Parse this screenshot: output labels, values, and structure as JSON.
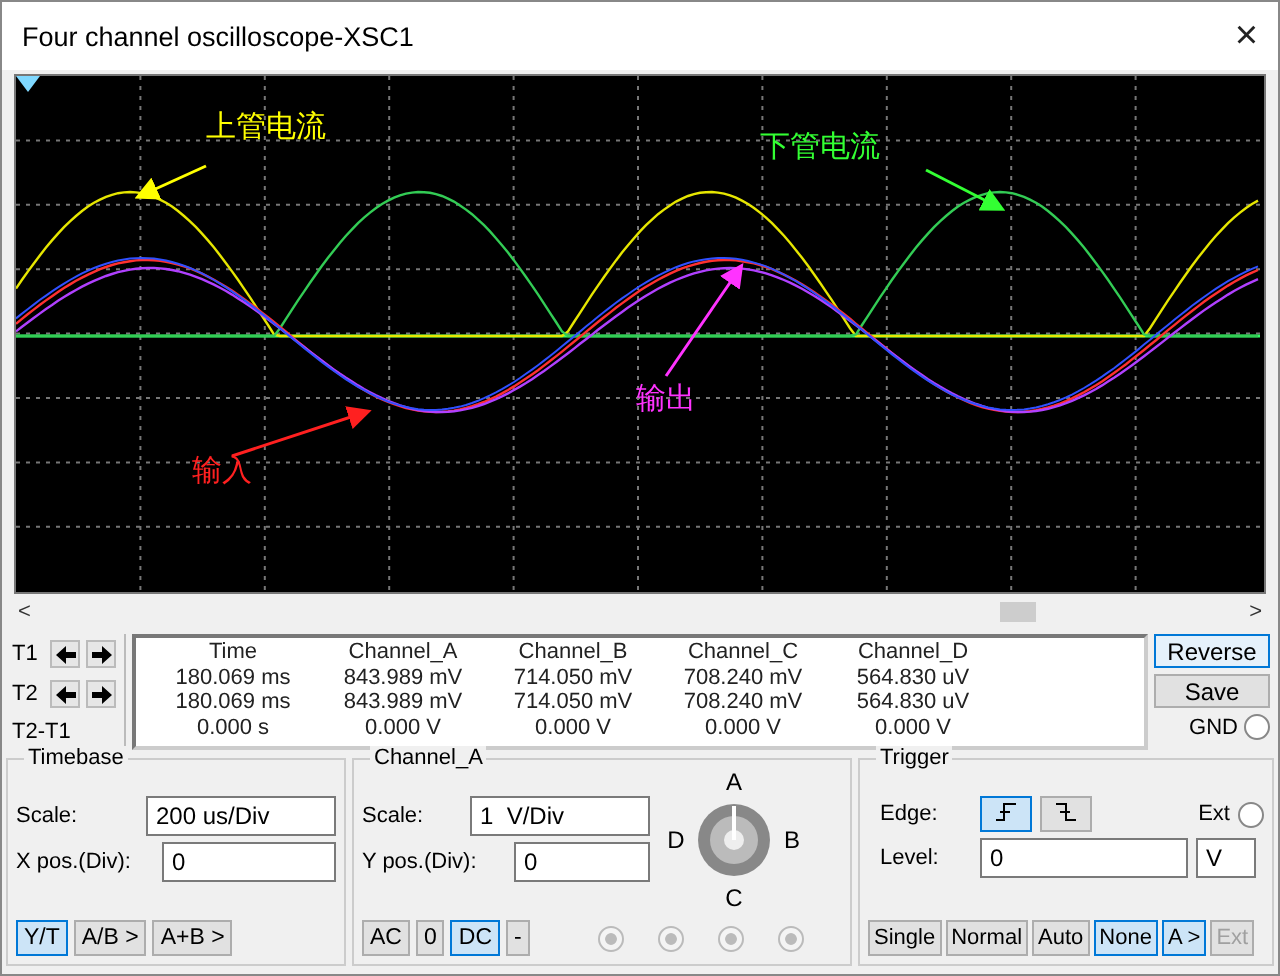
{
  "window": {
    "title": "Four channel oscilloscope-XSC1",
    "close": "×"
  },
  "scope": {
    "annotations": [
      {
        "text": "上管电流",
        "color": "#ffff00"
      },
      {
        "text": "下管电流",
        "color": "#33ff33"
      },
      {
        "text": "输出",
        "color": "#ff33ff"
      },
      {
        "text": "输入",
        "color": "#ff2020"
      }
    ]
  },
  "scrollbar": {
    "left": "<",
    "right": ">"
  },
  "cursors": {
    "labels": [
      "T1",
      "T2",
      "T2-T1"
    ],
    "columns": [
      "Time",
      "Channel_A",
      "Channel_B",
      "Channel_C",
      "Channel_D"
    ],
    "rows": [
      [
        "180.069 ms",
        "843.989 mV",
        "714.050 mV",
        "708.240 mV",
        "564.830 uV"
      ],
      [
        "180.069 ms",
        "843.989 mV",
        "714.050 mV",
        "708.240 mV",
        "564.830 uV"
      ],
      [
        "0.000 s",
        "0.000 V",
        "0.000 V",
        "0.000 V",
        "0.000 V"
      ]
    ]
  },
  "side_buttons": [
    {
      "label": "Reverse",
      "selected": true
    },
    {
      "label": "Save",
      "selected": false
    }
  ],
  "gnd": {
    "label": "GND",
    "checked": false
  },
  "timebase": {
    "title": "Timebase",
    "scale_label": "Scale:",
    "scale": "200 us/Div",
    "xpos_label": "X pos.(Div):",
    "xpos": "0",
    "modes": [
      {
        "label": "Y/T",
        "selected": true
      },
      {
        "label": "A/B >",
        "selected": false
      },
      {
        "label": "A+B >",
        "selected": false
      }
    ]
  },
  "channel": {
    "title": "Channel_A",
    "scale_label": "Scale:",
    "scale": "1  V/Div",
    "ypos_label": "Y pos.(Div):",
    "ypos": "0",
    "knob_labels": [
      "A",
      "D",
      "B",
      "C"
    ],
    "coupling": [
      {
        "label": "AC",
        "selected": false
      },
      {
        "label": "0",
        "selected": false
      },
      {
        "label": "DC",
        "selected": true
      },
      {
        "label": "-",
        "selected": false
      }
    ],
    "radios": [
      {
        "disabled": true
      },
      {
        "disabled": true
      },
      {
        "disabled": true
      },
      {
        "disabled": true
      }
    ]
  },
  "trigger": {
    "title": "Trigger",
    "edge_label": "Edge:",
    "edges": [
      {
        "kind": "rising",
        "selected": true
      },
      {
        "kind": "falling",
        "selected": false
      }
    ],
    "ext": {
      "label": "Ext",
      "checked": false
    },
    "level_label": "Level:",
    "level": "0",
    "unit": "V",
    "modes": [
      {
        "label": "Single",
        "selected": false,
        "disabled": false
      },
      {
        "label": "Normal",
        "selected": false,
        "disabled": false
      },
      {
        "label": "Auto",
        "selected": false,
        "disabled": false
      },
      {
        "label": "None",
        "selected": true,
        "disabled": false
      },
      {
        "label": "A >",
        "selected": true,
        "disabled": false
      },
      {
        "label": "Ext",
        "selected": false,
        "disabled": true
      }
    ]
  }
}
